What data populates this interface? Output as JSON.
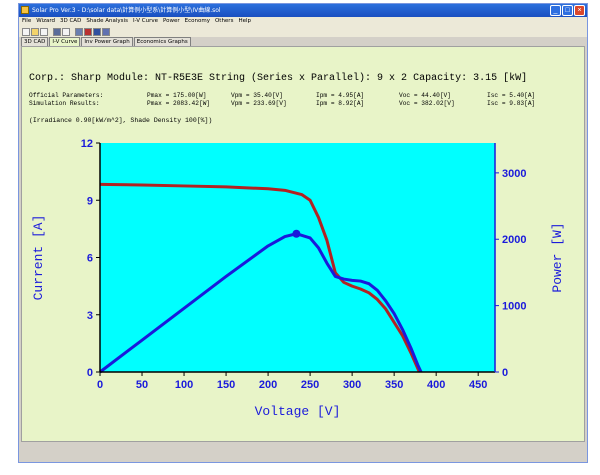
{
  "window": {
    "title": "Solar Pro  Ver.3 - D:\\solar data\\計算例小型系\\計算例小型\\IV曲線.sol",
    "minimize": "_",
    "maximize": "□",
    "close": "×"
  },
  "menu": [
    "File",
    "Wizard",
    "3D CAD",
    "Shade Analysis",
    "I-V Curve",
    "Power",
    "Economy",
    "Others",
    "Help"
  ],
  "toolbar_icons": [
    "new-file-icon",
    "open-folder-icon",
    "delete-icon",
    "save-icon",
    "print-icon",
    "image-icon",
    "chart-icon",
    "settings-icon",
    "info-icon"
  ],
  "tabs": [
    "3D CAD",
    "I-V Curve",
    "Inv Power Graph",
    "Economics Graphs"
  ],
  "active_tab": 1,
  "header": "Corp.: Sharp  Module: NT-R5E3E  String (Series x Parallel): 9 x 2  Capacity: 3.15 [kW]",
  "params": {
    "official_label": "Official Parameters:",
    "simulation_label": "Simulation Results:",
    "official": [
      "Pmax = 175.00[W]",
      "Vpm = 35.40[V]",
      "Ipm = 4.95[A]",
      "Voc = 44.40[V]",
      "Isc = 5.40[A]"
    ],
    "simulation": [
      "Pmax = 2083.42[W]",
      "Vpm = 233.69[V]",
      "Ipm = 8.92[A]",
      "Voc = 382.02[V]",
      "Isc = 9.83[A]"
    ]
  },
  "irradiance": "(Irradiance 0.90[kW/m^2], Shade Density 100[%])",
  "colors": {
    "plot_bg": "#00ffff",
    "current_curve": "#b22222",
    "power_curve": "#1a1adb",
    "left_axis": "#000000",
    "right_axis": "#1a1adb"
  },
  "chart_data": {
    "type": "line",
    "xlabel": "Voltage [V]",
    "ylabel": "Current [A]",
    "y2label": "Power [W]",
    "xlim": [
      0,
      470
    ],
    "ylim": [
      0,
      12
    ],
    "y2lim": [
      0,
      3450
    ],
    "xticks": [
      0,
      50,
      100,
      150,
      200,
      250,
      300,
      350,
      400,
      450
    ],
    "yticks": [
      0,
      3,
      6,
      9,
      12
    ],
    "y2ticks": [
      0,
      1000,
      2000,
      3000
    ],
    "grid": false,
    "series": [
      {
        "axis": "left",
        "x": [
          0,
          50,
          100,
          150,
          200,
          220,
          240,
          250,
          260,
          270,
          280,
          290,
          300,
          310,
          320,
          330,
          340,
          350,
          360,
          370,
          375,
          380
        ],
        "values": [
          9.83,
          9.8,
          9.75,
          9.7,
          9.6,
          9.52,
          9.3,
          9.0,
          8.1,
          6.9,
          5.2,
          4.7,
          4.5,
          4.35,
          4.15,
          3.8,
          3.3,
          2.6,
          1.9,
          1.0,
          0.5,
          0.0
        ]
      },
      {
        "axis": "right",
        "x": [
          0,
          50,
          100,
          150,
          200,
          220,
          233.69,
          250,
          260,
          270,
          280,
          290,
          300,
          310,
          320,
          330,
          340,
          350,
          360,
          370,
          378,
          382
        ],
        "values": [
          0,
          480,
          960,
          1440,
          1900,
          2040,
          2083,
          2020,
          1870,
          1640,
          1440,
          1400,
          1380,
          1370,
          1330,
          1230,
          1070,
          880,
          640,
          360,
          110,
          0
        ],
        "marker": {
          "x": 233.69,
          "y": 2083
        }
      }
    ]
  }
}
